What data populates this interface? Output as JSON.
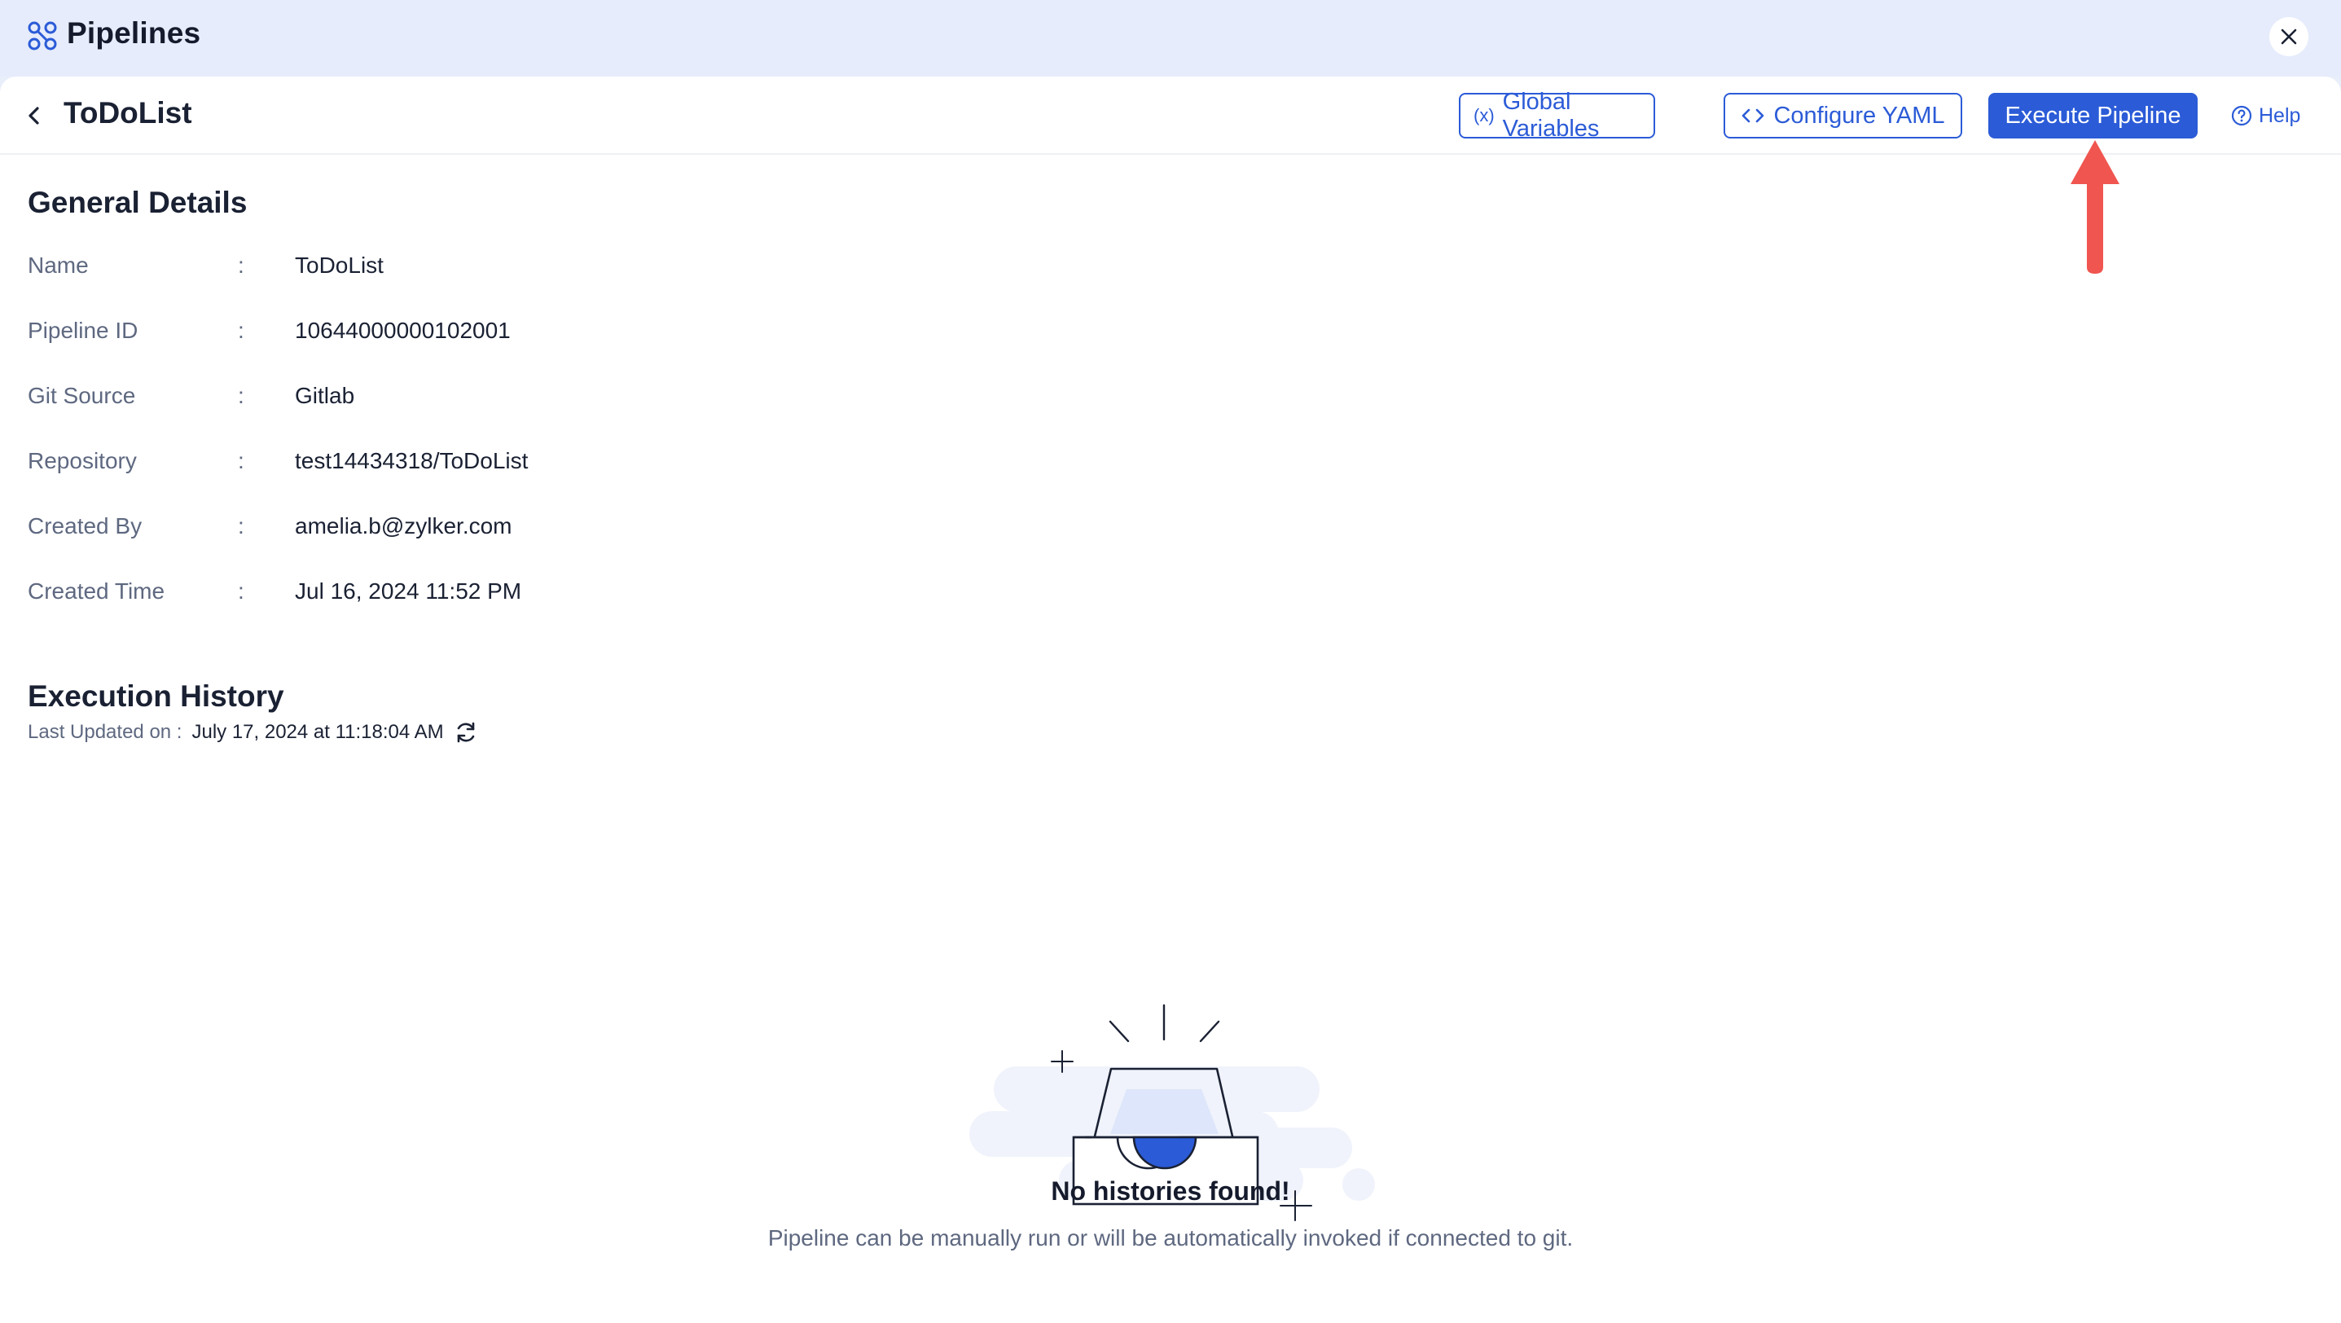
{
  "app": {
    "title": "Pipelines"
  },
  "header": {
    "title": "ToDoList",
    "buttons": {
      "global_variables": "Global Variables",
      "configure_yaml": "Configure YAML",
      "execute_pipeline": "Execute Pipeline",
      "help": "Help"
    }
  },
  "general": {
    "title": "General Details",
    "colon": ":",
    "rows": [
      {
        "label": "Name",
        "value": "ToDoList"
      },
      {
        "label": "Pipeline ID",
        "value": "10644000000102001"
      },
      {
        "label": "Git Source",
        "value": "Gitlab"
      },
      {
        "label": "Repository",
        "value": "test14434318/ToDoList"
      },
      {
        "label": "Created By",
        "value": "amelia.b@zylker.com"
      },
      {
        "label": "Created Time",
        "value": "Jul 16, 2024 11:52 PM"
      }
    ]
  },
  "history": {
    "title": "Execution History",
    "updated_label": "Last Updated on :",
    "updated_value": "July 17, 2024 at 11:18:04 AM",
    "empty_title": "No histories found!",
    "empty_subtitle": "Pipeline can be manually run or will be automatically invoked if connected to git."
  },
  "colors": {
    "accent": "#2b5bd7",
    "annotation_arrow": "#f0554f",
    "app_bar": "#e6ecfb"
  },
  "icons": [
    "pipelines-icon",
    "close-icon",
    "chevron-left-icon",
    "variable-icon",
    "code-icon",
    "help-circle-icon",
    "refresh-icon",
    "empty-inbox-illustration"
  ]
}
